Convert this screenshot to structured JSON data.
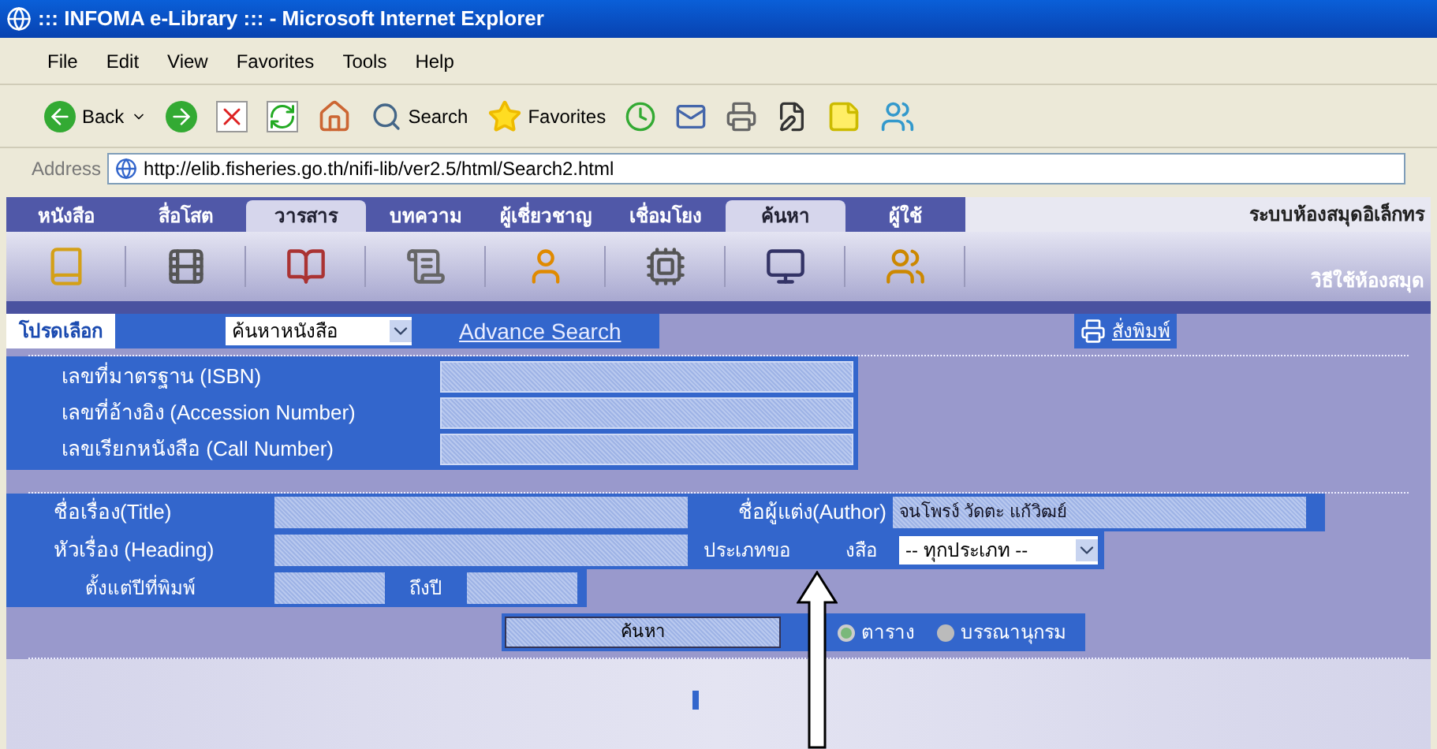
{
  "window": {
    "title": "::: INFOMA e-Library ::: - Microsoft Internet Explorer"
  },
  "menu": [
    "File",
    "Edit",
    "View",
    "Favorites",
    "Tools",
    "Help"
  ],
  "toolbar": {
    "back": "Back",
    "search": "Search",
    "favorites": "Favorites"
  },
  "address": {
    "label": "Address",
    "url": "http://elib.fisheries.go.th/nifi-lib/ver2.5/html/Search2.html"
  },
  "nav_tabs": [
    {
      "label": "หนังสือ",
      "selected": false
    },
    {
      "label": "สื่อโสต",
      "selected": false
    },
    {
      "label": "วารสาร",
      "selected": true
    },
    {
      "label": "บทความ",
      "selected": false
    },
    {
      "label": "ผู้เชี่ยวชาญ",
      "selected": false
    },
    {
      "label": "เชื่อมโยง",
      "selected": false
    },
    {
      "label": "ค้นหา",
      "selected": true
    },
    {
      "label": "ผู้ใช้",
      "selected": false
    }
  ],
  "site_title": "ระบบห้องสมุดอิเล็กทร",
  "help_link": "วิธีใช้ห้องสมุด",
  "choose": {
    "label": "โปรดเลือก",
    "select": "ค้นหาหนังสือ",
    "advance": "Advance Search",
    "print": "สั่งพิมพ์"
  },
  "id_fields": [
    {
      "label": "เลขที่มาตรฐาน (ISBN)"
    },
    {
      "label": "เลขที่อ้างอิง (Accession Number)"
    },
    {
      "label": "เลขเรียกหนังสือ (Call Number)"
    }
  ],
  "title_label": "ชื่อเรื่อง(Title)",
  "author_label": "ชื่อผู้แต่ง(Author)",
  "author_value": "จนโพรง์ วัดตะ แก้วิฒย์",
  "heading_label": "หัวเรื่อง (Heading)",
  "type_label_parts": [
    "ประเภทขอ",
    "งสือ"
  ],
  "type_select": "-- ทุกประเภท --",
  "year_from": "ตั้งแต่ปีที่พิมพ์",
  "year_to": "ถึงปี",
  "search_button": "ค้นหา",
  "display": [
    {
      "label": "ตาราง",
      "selected": true
    },
    {
      "label": "บรรณานุกรม",
      "selected": false
    }
  ]
}
